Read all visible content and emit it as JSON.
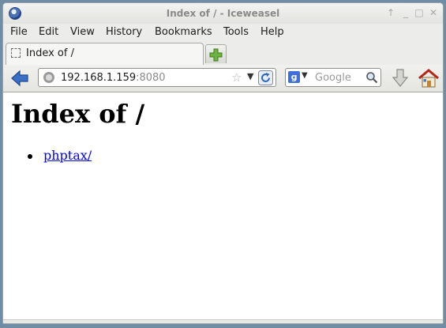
{
  "window": {
    "title": "Index of / - Iceweasel",
    "controls": [
      "pin-icon",
      "minimize-icon",
      "maximize-icon",
      "close-icon"
    ]
  },
  "menu": [
    "File",
    "Edit",
    "View",
    "History",
    "Bookmarks",
    "Tools",
    "Help"
  ],
  "tab": {
    "label": "Index of /"
  },
  "toolbar": {
    "url_host": "192.168.1.159",
    "url_port": ":8080",
    "search_placeholder": "Google"
  },
  "page": {
    "heading": "Index of /",
    "entries": [
      {
        "label": "phptax/"
      }
    ]
  },
  "colors": {
    "link": "#0000ee",
    "heading": "#000000",
    "accent": "#2f67c0"
  }
}
